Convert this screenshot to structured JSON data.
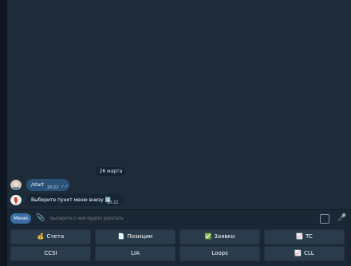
{
  "chat": {
    "date": "26 марта",
    "messages": [
      {
        "text": "/start",
        "time": "20:22",
        "direction": "out"
      },
      {
        "text": "Выберите пункт меню внизу",
        "emoji": "⬇️",
        "time": "20:22",
        "direction": "in"
      }
    ]
  },
  "input": {
    "menu_label": "Меню",
    "placeholder": "Выберите с чем будете работать"
  },
  "keyboard": {
    "row1": [
      {
        "emoji": "💰",
        "label": "Счета"
      },
      {
        "emoji": "📄",
        "label": "Позиции"
      },
      {
        "emoji": "✅",
        "label": "Заявки"
      },
      {
        "emoji": "📈",
        "label": "TC"
      }
    ],
    "row2": [
      {
        "emoji": "",
        "label": "CCSI"
      },
      {
        "emoji": "",
        "label": "LIA"
      },
      {
        "emoji": "",
        "label": "Loops"
      },
      {
        "emoji": "📈",
        "label": "CLL"
      }
    ]
  },
  "colors": {
    "accent": "#3a6ea5",
    "bubble_out": "#2b5278",
    "bubble_in": "#172635",
    "check": "#7ac0ff"
  }
}
